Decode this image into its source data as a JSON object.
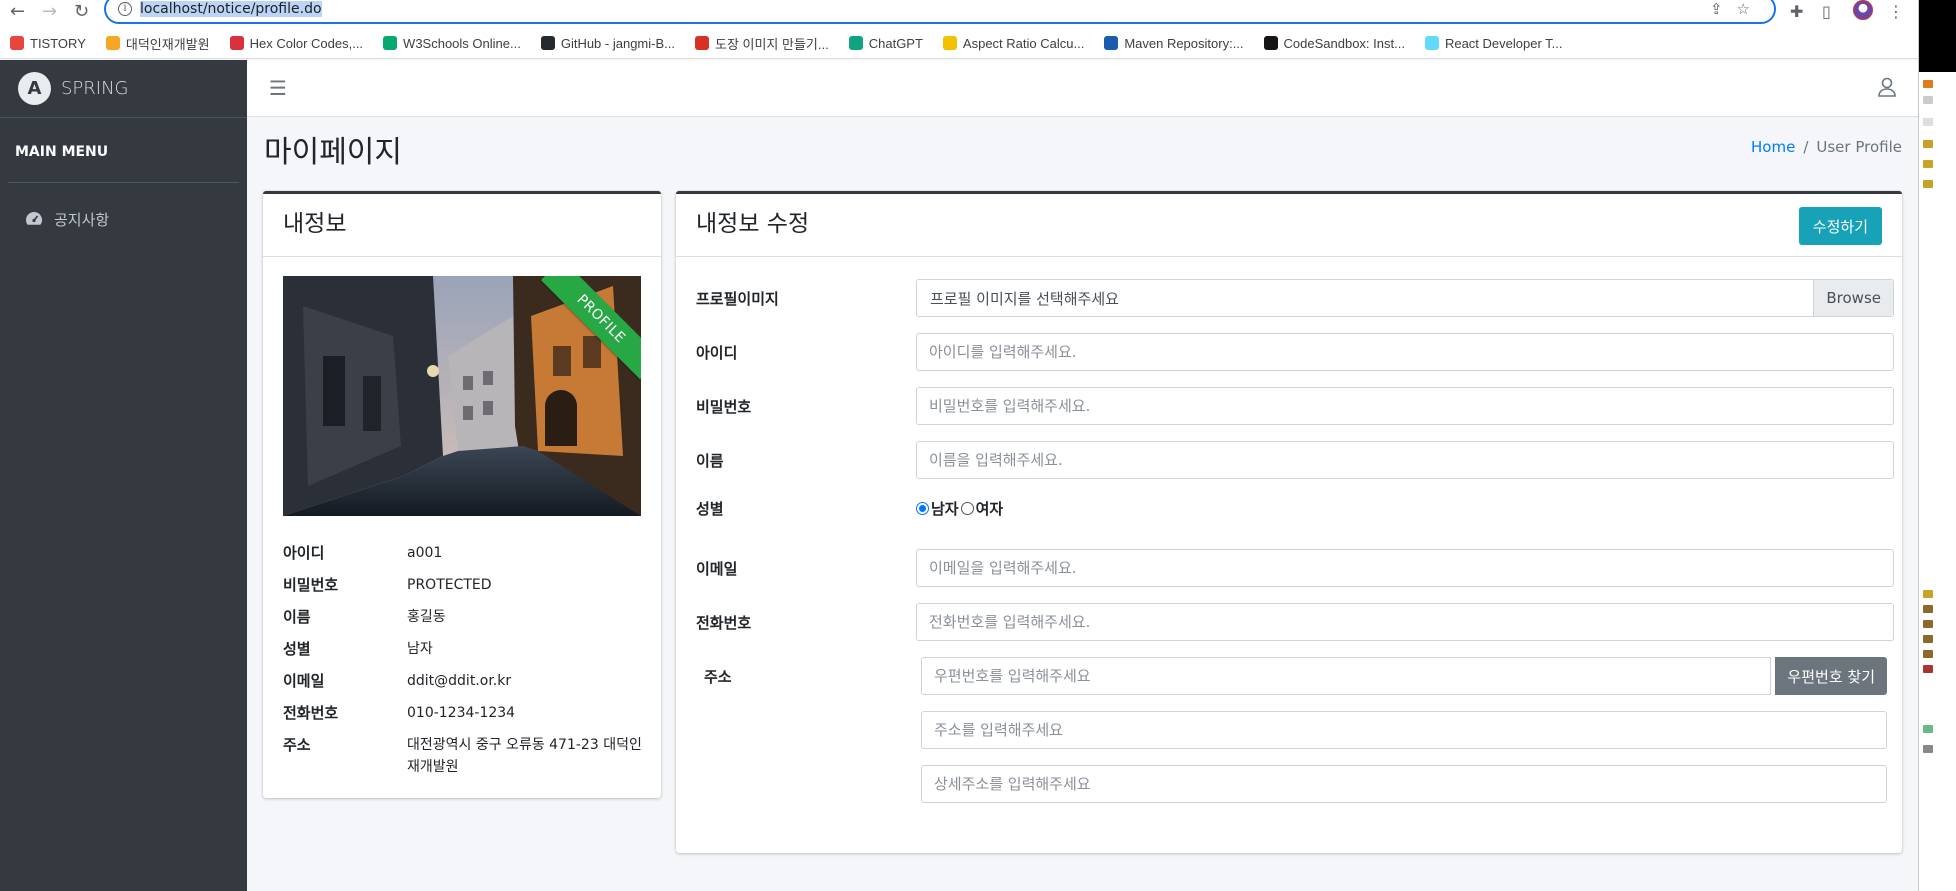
{
  "browser": {
    "url": "localhost/notice/profile.do",
    "bookmarks": [
      {
        "label": "TISTORY",
        "color": "#e8453c"
      },
      {
        "label": "대덕인재개발원",
        "color": "#f5a623"
      },
      {
        "label": "Hex Color Codes,...",
        "color": "#d9303e"
      },
      {
        "label": "W3Schools Online...",
        "color": "#04aa6d"
      },
      {
        "label": "GitHub - jangmi-B...",
        "color": "#24292e"
      },
      {
        "label": "도장 이미지 만들기...",
        "color": "#d93025"
      },
      {
        "label": "ChatGPT",
        "color": "#10a37f"
      },
      {
        "label": "Aspect Ratio Calcu...",
        "color": "#f2c200"
      },
      {
        "label": "Maven Repository:...",
        "color": "#1a5dab"
      },
      {
        "label": "CodeSandbox: Inst...",
        "color": "#151515"
      },
      {
        "label": "React Developer T...",
        "color": "#61dafb"
      }
    ]
  },
  "sidebar": {
    "brand": "SPRING",
    "brand_logo": "A",
    "menu_header": "MAIN MENU",
    "items": [
      {
        "label": "공지사항",
        "icon": "tachometer-icon"
      }
    ]
  },
  "header": {
    "title": "마이페이지",
    "breadcrumb": {
      "home": "Home",
      "current": "User Profile"
    }
  },
  "profile_card": {
    "title": "내정보",
    "ribbon": "PROFILE",
    "fields": [
      {
        "label": "아이디",
        "value": "a001"
      },
      {
        "label": "비밀번호",
        "value": "PROTECTED"
      },
      {
        "label": "이름",
        "value": "홍길동"
      },
      {
        "label": "성별",
        "value": "남자"
      },
      {
        "label": "이메일",
        "value": "ddit@ddit.or.kr"
      },
      {
        "label": "전화번호",
        "value": "010-1234-1234"
      },
      {
        "label": "주소",
        "value": "대전광역시 중구 오류동 471-23 대덕인재개발원"
      }
    ]
  },
  "edit_card": {
    "title": "내정보 수정",
    "submit": "수정하기",
    "profile_image": {
      "label": "프로필이미지",
      "text": "프로필 이미지를 선택해주세요",
      "browse": "Browse"
    },
    "id": {
      "label": "아이디",
      "placeholder": "아이디를 입력해주세요."
    },
    "password": {
      "label": "비밀번호",
      "placeholder": "비밀번호를 입력해주세요."
    },
    "name": {
      "label": "이름",
      "placeholder": "이름을 입력해주세요."
    },
    "gender": {
      "label": "성별",
      "options": [
        "남자",
        "여자"
      ],
      "selected": "남자"
    },
    "email": {
      "label": "이메일",
      "placeholder": "이메일을 입력해주세요."
    },
    "phone": {
      "label": "전화번호",
      "placeholder": "전화번호를 입력해주세요."
    },
    "address": {
      "label": "주소",
      "zip_placeholder": "우편번호를 입력해주세요",
      "zip_button": "우편번호 찾기",
      "addr1_placeholder": "주소를 입력해주세요",
      "addr2_placeholder": "상세주소를 입력해주세요"
    }
  },
  "colors": {
    "sidebar": "#343a40",
    "accent": "#17a2b8",
    "ribbon": "#28a745",
    "link": "#007bff"
  }
}
